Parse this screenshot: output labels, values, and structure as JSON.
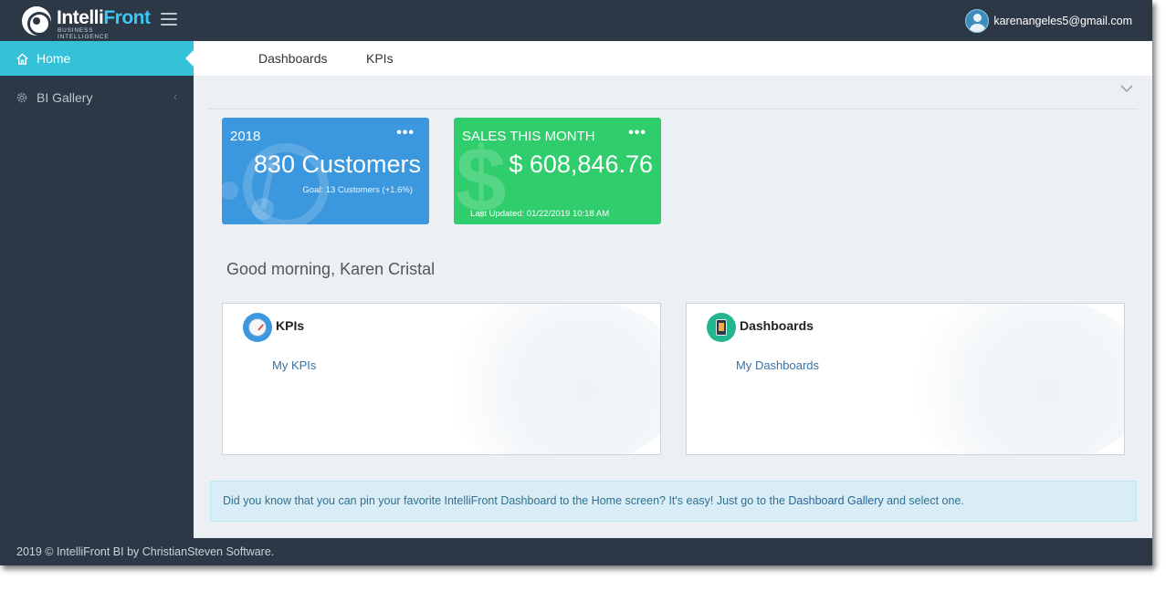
{
  "header": {
    "logo_main": "Intelli",
    "logo_accent": "Front",
    "logo_sub": "BUSINESS INTELLIGENCE",
    "user_email": "karenangeles5@gmail.com"
  },
  "sidebar": {
    "items": [
      {
        "label": "Home",
        "icon": "home-icon",
        "active": true
      },
      {
        "label": "BI Gallery",
        "icon": "gear-icon",
        "active": false
      }
    ]
  },
  "subnav": {
    "tabs": [
      {
        "label": "Dashboards"
      },
      {
        "label": "KPIs"
      }
    ]
  },
  "cards": {
    "customers": {
      "title": "2018",
      "value": "830 Customers",
      "note": "Goal: 13 Customers (+1.6%)",
      "color": "#3b97de"
    },
    "sales": {
      "title": "SALES THIS MONTH",
      "value": "$ 608,846.76",
      "note": "Last Updated: 01/22/2019 10:18 AM",
      "color": "#30cd6c"
    }
  },
  "greeting": "Good morning, Karen Cristal",
  "panels": {
    "kpis": {
      "title": "KPIs",
      "link": "My KPIs"
    },
    "dashboards": {
      "title": "Dashboards",
      "link": "My Dashboards"
    }
  },
  "info": {
    "text_before": "Did you know that you can pin your favorite IntelliFront Dashboard to the Home screen? It's easy! Just go to the ",
    "link": "Dashboard Gallery",
    "text_after": " and select one."
  },
  "footer": {
    "text": "2019 © IntelliFront BI by ChristianSteven Software."
  },
  "colors": {
    "header_bg": "#2d3846",
    "active_item": "#35c1d7",
    "link": "#3a71a8"
  }
}
